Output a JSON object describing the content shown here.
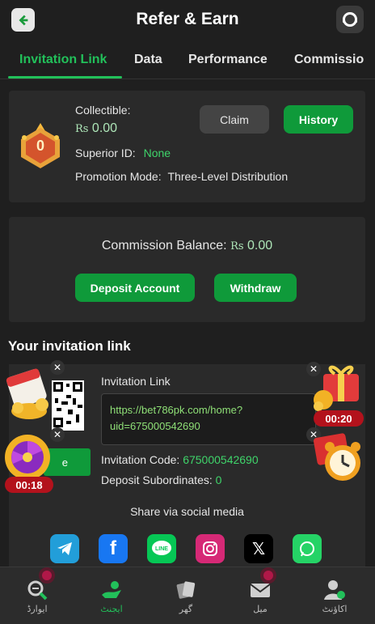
{
  "header": {
    "title": "Refer & Earn"
  },
  "tabs": [
    "Invitation Link",
    "Data",
    "Performance",
    "Commissio"
  ],
  "summary": {
    "collectible_label": "Collectible:",
    "currency": "Rs",
    "collectible_value": "0.00",
    "claim_label": "Claim",
    "history_label": "History",
    "superior_label": "Superior ID:",
    "superior_value": "None",
    "promotion_label": "Promotion Mode:",
    "promotion_value": "Three-Level Distribution",
    "badge_level": "0"
  },
  "commission": {
    "label": "Commission Balance:",
    "currency": "Rs",
    "value": "0.00",
    "deposit_label": "Deposit Account",
    "withdraw_label": "Withdraw"
  },
  "invite": {
    "section_title": "Your invitation link",
    "link_label": "Invitation Link",
    "link_value": "https://bet786pk.com/home?uid=675000542690",
    "code_label": "Invitation Code:",
    "code_value": "675000542690",
    "subordinates_label": "Deposit Subordinates:",
    "subordinates_value": "0",
    "share_title": "Share via social media",
    "save_fragment": "e"
  },
  "floats": {
    "left_timer": "00:18",
    "right_timer": "00:20"
  },
  "nav": [
    {
      "label": "ایوارڈ",
      "icon": "search-award-icon"
    },
    {
      "label": "ایجنٹ",
      "icon": "agent-icon"
    },
    {
      "label": "گھر",
      "icon": "home-cards-icon"
    },
    {
      "label": "میل",
      "icon": "mail-icon"
    },
    {
      "label": "اکاؤنٹ",
      "icon": "account-icon"
    }
  ],
  "colors": {
    "accent": "#22c05a",
    "button_green": "#0f9a3a",
    "background": "#1f1f1f",
    "card": "#2a2a2a"
  }
}
